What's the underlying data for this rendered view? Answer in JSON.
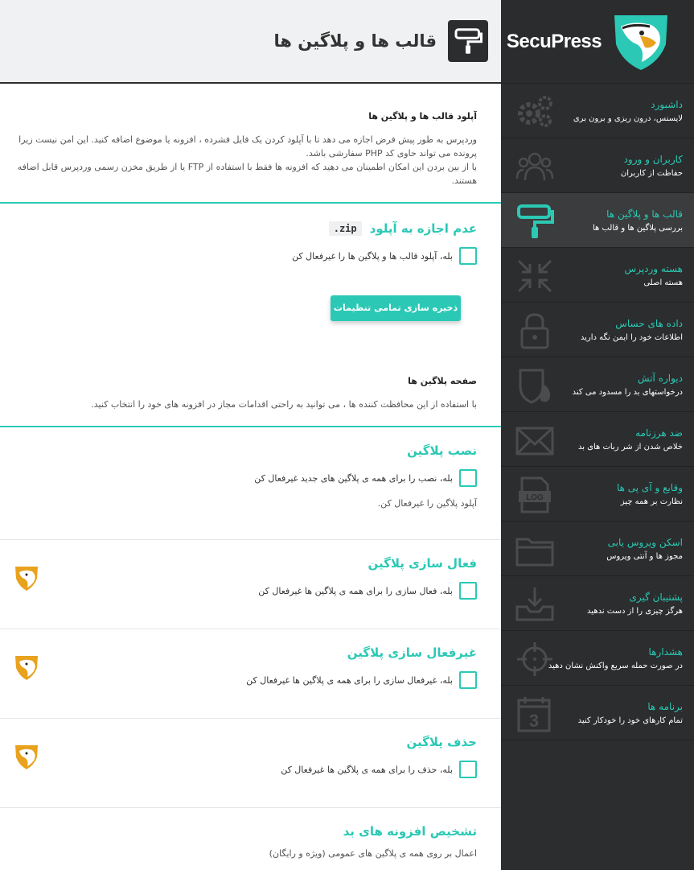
{
  "brand": {
    "name": "SecuPress"
  },
  "page": {
    "title": "قالب ها و پلاگین ها"
  },
  "sidebar": {
    "items": [
      {
        "title": "داشبورد",
        "subtitle": "لایسنس، درون ریزی و برون بری",
        "icon": "gears-icon"
      },
      {
        "title": "کاربران و ورود",
        "subtitle": "حفاظت از کاربران",
        "icon": "users-icon"
      },
      {
        "title": "قالب ها و پلاگین ها",
        "subtitle": "بررسی پلاگین ها و قالب ها",
        "icon": "paint-roller-icon"
      },
      {
        "title": "هسته وردپرس",
        "subtitle": "هسته اصلی",
        "icon": "compress-arrows-icon"
      },
      {
        "title": "داده های حساس",
        "subtitle": "اطلاعات خود را ایمن نگه دارید",
        "icon": "padlock-icon"
      },
      {
        "title": "دیواره آتش",
        "subtitle": "درخواستهای بد را مسدود می کند",
        "icon": "shield-fire-icon"
      },
      {
        "title": "ضد هرزنامه",
        "subtitle": "خلاص شدن از شر ربات های بد",
        "icon": "envelope-icon"
      },
      {
        "title": "وقایع و آی پی ها",
        "subtitle": "نظارت بر همه چیز",
        "icon": "log-file-icon"
      },
      {
        "title": "اسکن ویروس یابی",
        "subtitle": "مجوز ها و آنتی ویروس",
        "icon": "folder-icon"
      },
      {
        "title": "پشتیبان گیری",
        "subtitle": "هرگز چیزی را از دست ندهید",
        "icon": "inbox-download-icon"
      },
      {
        "title": "هشدارها",
        "subtitle": "در صورت حمله سریع واکنش نشان دهید",
        "icon": "crosshair-icon"
      },
      {
        "title": "برنامه ها",
        "subtitle": "تمام کارهای خود را خودکار کنید",
        "icon": "calendar-icon"
      }
    ]
  },
  "upload_section": {
    "title": "آپلود قالب ها و پلاگین ها",
    "desc1": "وردپرس به طور پیش فرض اجازه می دهد تا با آپلود کردن یک فایل فشرده ، افزونه یا موضوع اضافه کنید. این امن نیست زیرا پرونده می تواند حاوی کد PHP سفارشی باشد.",
    "desc2": "با از بین بردن این امکان اطمینان می دهید که افزونه ها فقط با استفاده از FTP یا از طریق مخزن رسمی وردپرس قابل اضافه هستند.",
    "option_title": "عدم اجازه به آپلود",
    "option_code": ".zip",
    "option_check": "بله، آپلود قالب ها و پلاگین ها را غیرفعال کن",
    "save_label": "ذخیره سازی تمامی تنظیمات"
  },
  "plugins_section": {
    "title": "صفحه پلاگین ها",
    "desc": "با استفاده از این محافظت کننده ها ، می توانید به راحتی اقدامات مجاز در افزونه های خود را انتخاب کنید.",
    "install": {
      "title": "نصب پلاگین",
      "check": "بله، نصب را برای همه ی پلاگین های جدید غیرفعال کن",
      "note": "آپلود پلاگین را غیرفعال کن."
    },
    "activate": {
      "title": "فعال سازی پلاگین",
      "check": "بله، فعال سازی را برای همه ی پلاگین ها غیرفعال کن"
    },
    "deactivate": {
      "title": "غیرفعال سازی پلاگین",
      "check": "بله، غیرفعال سازی را برای همه ی پلاگین ها غیرفعال کن"
    },
    "delete": {
      "title": "حذف پلاگین",
      "check": "بله، حذف را برای همه ی پلاگین ها غیرفعال کن"
    },
    "detect": {
      "title": "تشخیص افزونه های بد",
      "note": "اعمال بر روی همه ی پلاگین های عمومی (ویژه و رایگان)"
    }
  },
  "colors": {
    "accent": "#2bc9b5",
    "sidebar_bg": "#2b2d2e",
    "header_bg": "#f0f1f2"
  }
}
